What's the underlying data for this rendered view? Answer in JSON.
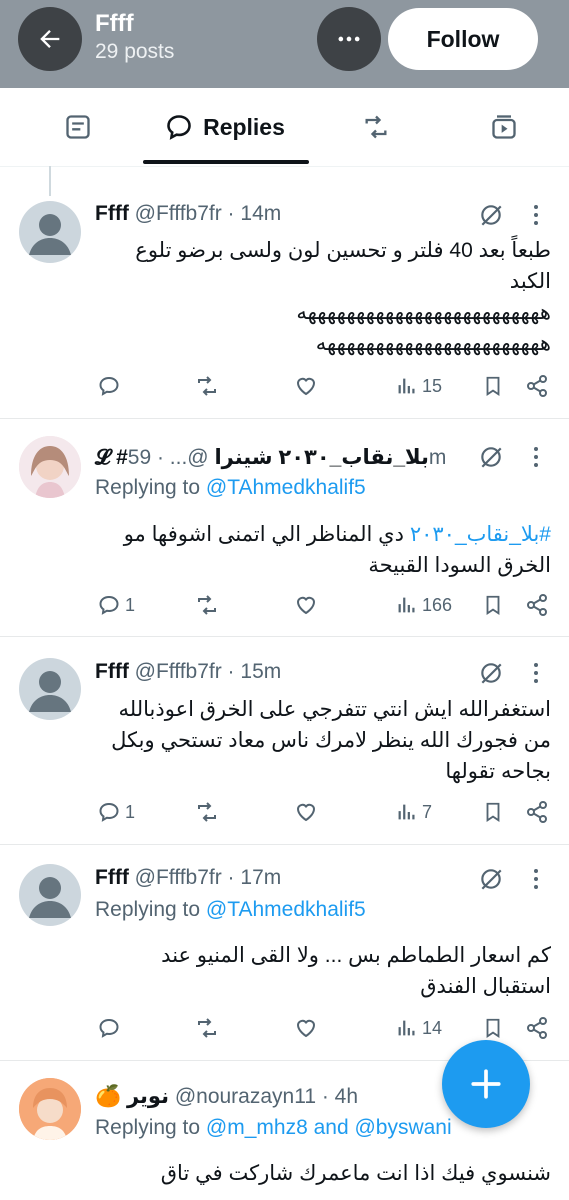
{
  "header": {
    "title": "Ffff",
    "posts_count": "29 posts",
    "follow_label": "Follow",
    "icons": [
      "back-arrow-icon",
      "more-icon"
    ]
  },
  "tabs": [
    {
      "label": "",
      "icon": "posts-icon"
    },
    {
      "label": "Replies",
      "icon": "reply-bubble-icon",
      "active": true
    },
    {
      "label": "",
      "icon": "repost-icon"
    },
    {
      "label": "",
      "icon": "media-icon"
    }
  ],
  "tweets": [
    {
      "name": "Ffff",
      "meta": " @Ffffb7fr · 14m",
      "replying_prefix": "",
      "replying_to": "",
      "text_lines": [
        "طبعاً بعد 40 فلتر و تحسين لون ولسى برضو تلوع",
        "الكبد",
        "هههههههههههههههههههههههههه",
        "هههههههههههههههههههههههه"
      ],
      "replies": "",
      "views": "15"
    },
    {
      "name": "𝓛 #بلا_نقاب_٢٠٣٠ شينرا",
      "meta": " @... · 59m",
      "replying_prefix": "Replying to ",
      "replying_to": "@TAhmedkhalif5",
      "hashtag": "#بلا_نقاب_٢٠٣٠",
      "text_lines": [
        " دي المناظر الي اتمنى اشوفها مو",
        "الخرق السودا القبيحة"
      ],
      "replies": "1",
      "views": "166"
    },
    {
      "name": "Ffff",
      "meta": " @Ffffb7fr · 15m",
      "replying_prefix": "",
      "replying_to": "",
      "text_lines": [
        "استغفرالله ايش انتي تتفرجي على الخرق اعوذبالله",
        "من فجورك الله ينظر لامرك ناس معاد تستحي وبكل",
        "بجاحه تقولها"
      ],
      "replies": "1",
      "views": "7"
    },
    {
      "name": "Ffff",
      "meta": " @Ffffb7fr · 17m",
      "replying_prefix": "Replying to ",
      "replying_to": "@TAhmedkhalif5",
      "text_lines": [
        "كم اسعار الطماطم بس ... ولا القى المنيو عند",
        "استقبال الفندق"
      ],
      "replies": "",
      "views": "14"
    },
    {
      "name": "🍊 نوير",
      "meta": " @nourazayn11 · 4h",
      "replying_prefix": "Replying to ",
      "replying_to": "@m_mhz8 and @byswani",
      "text_lines": [
        "شنسوي فيك اذا انت ماعمرك شاركت في تاق"
      ],
      "replies": "",
      "views": ""
    }
  ],
  "colors": {
    "header_bg": "#8e979f",
    "accent": "#1d9bf0",
    "text": "#0f1419",
    "secondary": "#536471"
  }
}
